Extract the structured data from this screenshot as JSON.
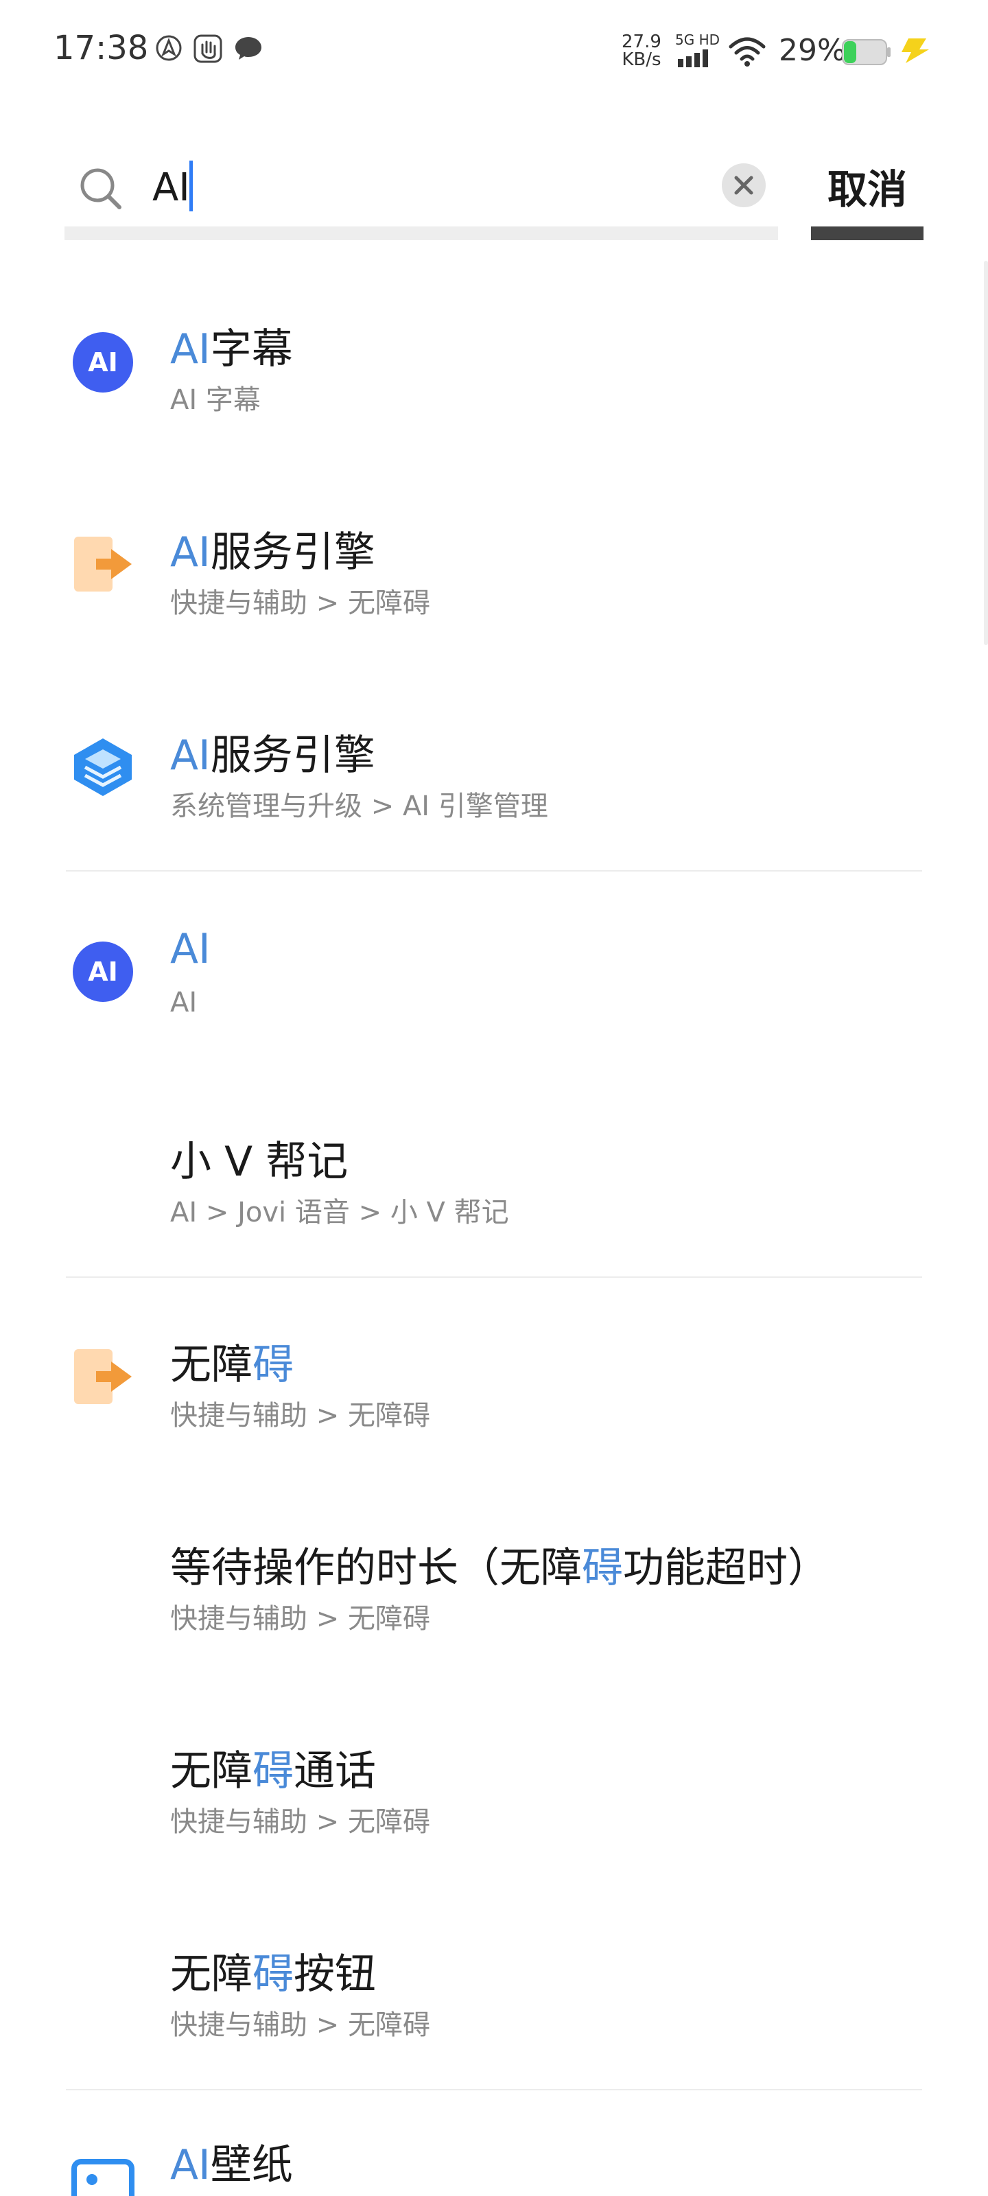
{
  "status_bar": {
    "time": "17:38",
    "net_speed_value": "27.9",
    "net_speed_unit": "KB/s",
    "network_type": "5G HD",
    "battery_percent": "29%",
    "icons": [
      "location-icon",
      "hand-icon",
      "message-icon",
      "signal-icon",
      "wifi-icon",
      "battery-icon",
      "charging-icon"
    ]
  },
  "search": {
    "query": "AI",
    "cancel_label": "取消"
  },
  "colors": {
    "highlight": "#4a8ad8",
    "ai_icon": "#3f5ef0",
    "orange_icon": "#f29a3a",
    "blue_layer_icon": "#2f8ef0"
  },
  "results": [
    {
      "title_pre": "",
      "title_hl": "AI",
      "title_post": "字幕",
      "path": "AI 字幕",
      "icon": "ai-badge-icon"
    },
    {
      "title_pre": "",
      "title_hl": "AI",
      "title_post": "服务引擎",
      "path": "快捷与辅助 > 无障碍",
      "icon": "accessibility-arrow-icon"
    },
    {
      "title_pre": "",
      "title_hl": "AI",
      "title_post": "服务引擎",
      "path": "系统管理与升级 > AI 引擎管理",
      "icon": "layers-icon"
    },
    {
      "title_pre": "",
      "title_hl": "AI",
      "title_post": "",
      "path": "AI",
      "icon": "ai-badge-icon"
    },
    {
      "title_pre": "小 V 帮记",
      "title_hl": "",
      "title_post": "",
      "path": "AI > Jovi 语音 > 小 V 帮记",
      "icon": ""
    },
    {
      "title_pre": "无障",
      "title_hl": "碍",
      "title_post": "",
      "path": "快捷与辅助 > 无障碍",
      "icon": "accessibility-arrow-icon"
    },
    {
      "title_pre": "等待操作的时长（无障",
      "title_hl": "碍",
      "title_post": "功能超时）",
      "path": "快捷与辅助 > 无障碍",
      "icon": ""
    },
    {
      "title_pre": "无障",
      "title_hl": "碍",
      "title_post": "通话",
      "path": "快捷与辅助 > 无障碍",
      "icon": ""
    },
    {
      "title_pre": "无障",
      "title_hl": "碍",
      "title_post": "按钮",
      "path": "快捷与辅助 > 无障碍",
      "icon": ""
    },
    {
      "title_pre": "",
      "title_hl": "AI",
      "title_post": "壁纸",
      "path": "",
      "icon": "wallpaper-icon"
    }
  ]
}
